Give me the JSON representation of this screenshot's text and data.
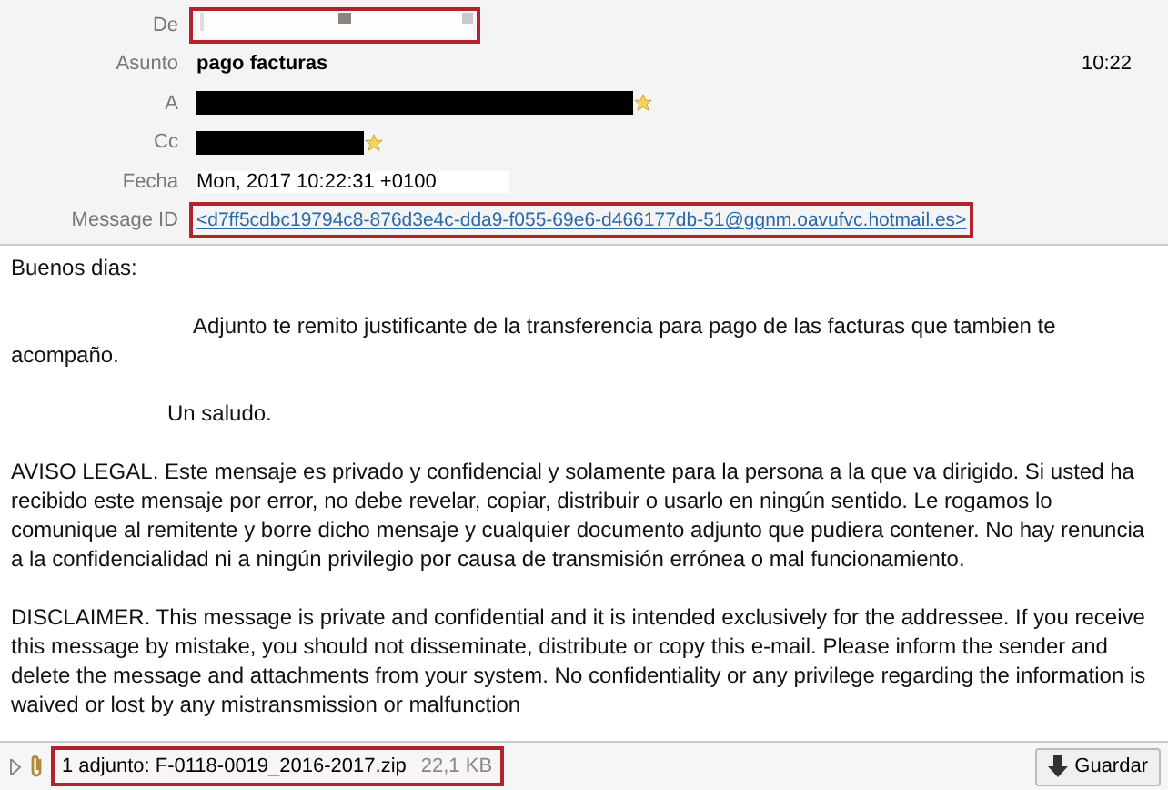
{
  "header": {
    "fields": [
      {
        "label": "De",
        "kind": "redacted",
        "highlighted": true
      },
      {
        "label": "Asunto",
        "kind": "subject",
        "value": "pago facturas",
        "time": "10:22",
        "highlighted": false
      },
      {
        "label": "A",
        "kind": "blackout",
        "starred": true,
        "highlighted": false
      },
      {
        "label": "Cc",
        "kind": "blackout",
        "starred": true,
        "highlighted": false
      },
      {
        "label": "Fecha",
        "kind": "text",
        "value": "Mon,  2017 10:22:31 +0100",
        "highlighted": false
      },
      {
        "label": "Message ID",
        "kind": "link",
        "value": "<d7ff5cdbc19794c8-876d3e4c-dda9-f055-69e6-d466177db-51@ggnm.oavufvc.hotmail.es>",
        "highlighted": true
      }
    ]
  },
  "body": {
    "paragraphs": [
      {
        "kind": "plain",
        "text": "Buenos dias:"
      },
      {
        "kind": "indented",
        "text": "Adjunto te remito justificante de la transferencia para pago de las facturas que tambien te acompaño."
      },
      {
        "kind": "indented-short",
        "text": "Un saludo."
      },
      {
        "kind": "plain",
        "text": "AVISO LEGAL. Este mensaje es privado y confidencial y solamente para la persona a la que va dirigido. Si usted ha recibido este mensaje por error, no debe revelar, copiar, distribuir o usarlo en ningún sentido. Le rogamos lo comunique al remitente y borre dicho mensaje y cualquier documento adjunto que pudiera contener. No hay renuncia a la confidencialidad ni a ningún privilegio por causa de transmisión errónea o mal funcionamiento."
      },
      {
        "kind": "plain",
        "text": "DISCLAIMER. This message is private and confidential and it is intended exclusively for the addressee. If you receive this message by mistake, you should not disseminate, distribute or copy this e-mail. Please inform the sender and delete the message and attachments from your system. No confidentiality or any privilege regarding the information is waived or lost by any mistransmission or malfunction"
      }
    ]
  },
  "attachments": {
    "expanded": false,
    "summary": "1 adjunto: F-0118-0019_2016-2017.zip",
    "size": "22,1 KB",
    "highlighted": true,
    "save_button": "Guardar"
  }
}
